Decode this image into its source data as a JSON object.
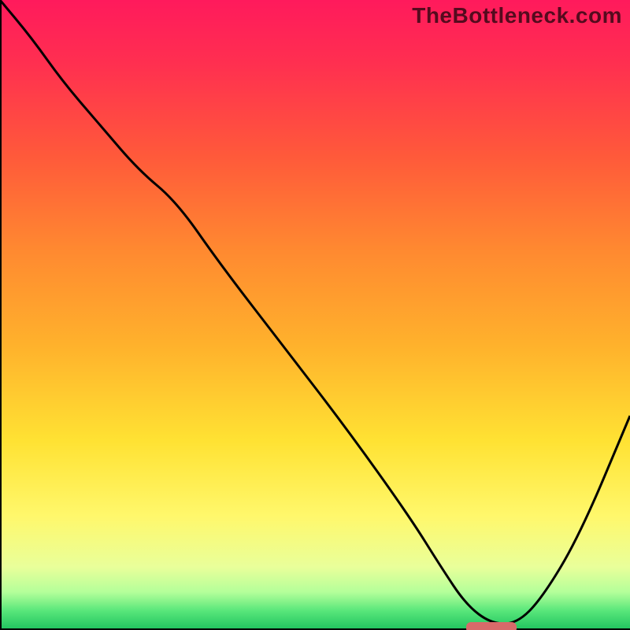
{
  "watermark": "TheBottleneck.com",
  "chart_data": {
    "type": "line",
    "title": "",
    "xlabel": "",
    "ylabel": "",
    "xlim": [
      0,
      100
    ],
    "ylim": [
      0,
      100
    ],
    "x": [
      0,
      5,
      10,
      16,
      22,
      28,
      35,
      45,
      55,
      65,
      70,
      74,
      78,
      82,
      86,
      92,
      100
    ],
    "values": [
      100,
      94,
      87,
      80,
      73,
      68,
      58,
      45,
      32,
      18,
      10,
      4,
      1,
      1,
      5,
      15,
      34
    ],
    "marker": {
      "x_start": 74,
      "x_end": 82,
      "y": 0.5
    },
    "colors": {
      "curve": "#000000",
      "marker": "#d86a6a",
      "gradient_stops": [
        "#ff1a5c",
        "#ff5a3a",
        "#ffb22c",
        "#fff86c",
        "#1fc25e"
      ]
    }
  }
}
